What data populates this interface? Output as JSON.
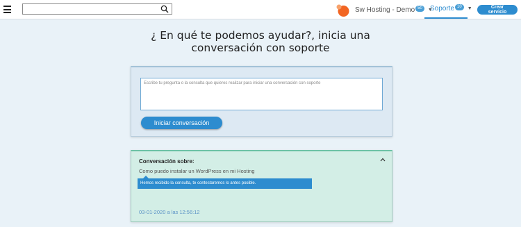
{
  "header": {
    "menu_icon": "hamburger-menu-icon",
    "search": {
      "value": "",
      "placeholder": "",
      "icon": "search-icon"
    },
    "brand": {
      "name": "Sw Hosting - Demo",
      "badge": "50",
      "logo_color": "#f26522"
    },
    "support": {
      "label": "Soporte",
      "badge": "10"
    },
    "create_button": "Crear servicio",
    "accent_color": "#2d8ccf"
  },
  "main": {
    "title": "¿ En qué te podemos ayudar?, inicia una conversación con soporte",
    "question_placeholder": "Escribe tu pregunta o la consulta que quieres realizar para iniciar una conversación con soporte",
    "start_button": "Iniciar conversación"
  },
  "conversation": {
    "label": "Conversación sobre:",
    "subject": "Como puedo instalar un WordPress en mi Hosting",
    "message": "Hemos recibido la consulta, te contestaremos lo antes posible.",
    "date": "03-01-2020 a las 12:56:12",
    "collapse_icon": "chevron-up-icon"
  }
}
